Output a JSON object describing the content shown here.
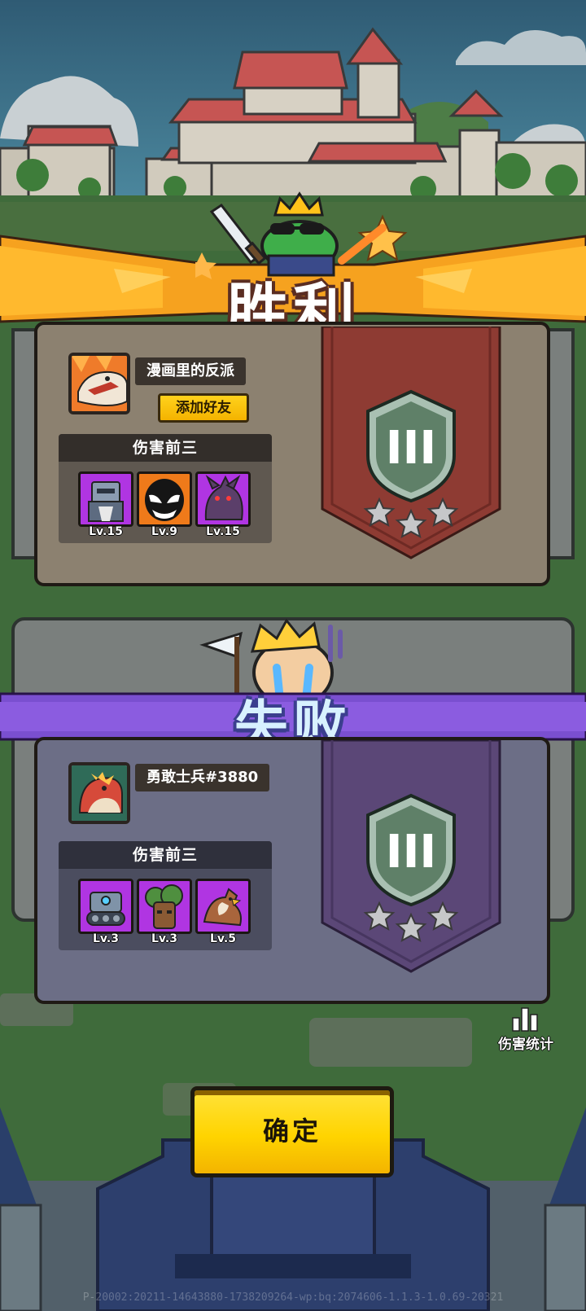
{
  "victory": {
    "title": "胜利",
    "player_name": "漫画里的反派",
    "add_friend_label": "添加好友",
    "top3_title": "伤害前三",
    "heroes": [
      {
        "level": "Lv.15",
        "frame": "purple",
        "icon": "robot-knight-icon"
      },
      {
        "level": "Lv.9",
        "frame": "orange",
        "icon": "venom-icon"
      },
      {
        "level": "Lv.15",
        "frame": "purple",
        "icon": "werewolf-icon"
      }
    ],
    "rank": "III",
    "stars": 3,
    "banner_color": "#8e3b33"
  },
  "defeat": {
    "title": "失败",
    "player_name": "勇敢士兵#3880",
    "top3_title": "伤害前三",
    "heroes": [
      {
        "level": "Lv.3",
        "frame": "purple",
        "icon": "tank-robot-icon"
      },
      {
        "level": "Lv.3",
        "frame": "purple",
        "icon": "treant-icon"
      },
      {
        "level": "Lv.5",
        "frame": "purple",
        "icon": "griffin-icon"
      }
    ],
    "rank": "III",
    "stars": 3,
    "banner_color": "#5b4777"
  },
  "damage_stats_label": "伤害统计",
  "confirm_label": "确定",
  "build_info": "P-20002:20211-14643880-1738209264-wp:bq:2074606-1.1.3-1.0.69-20321"
}
